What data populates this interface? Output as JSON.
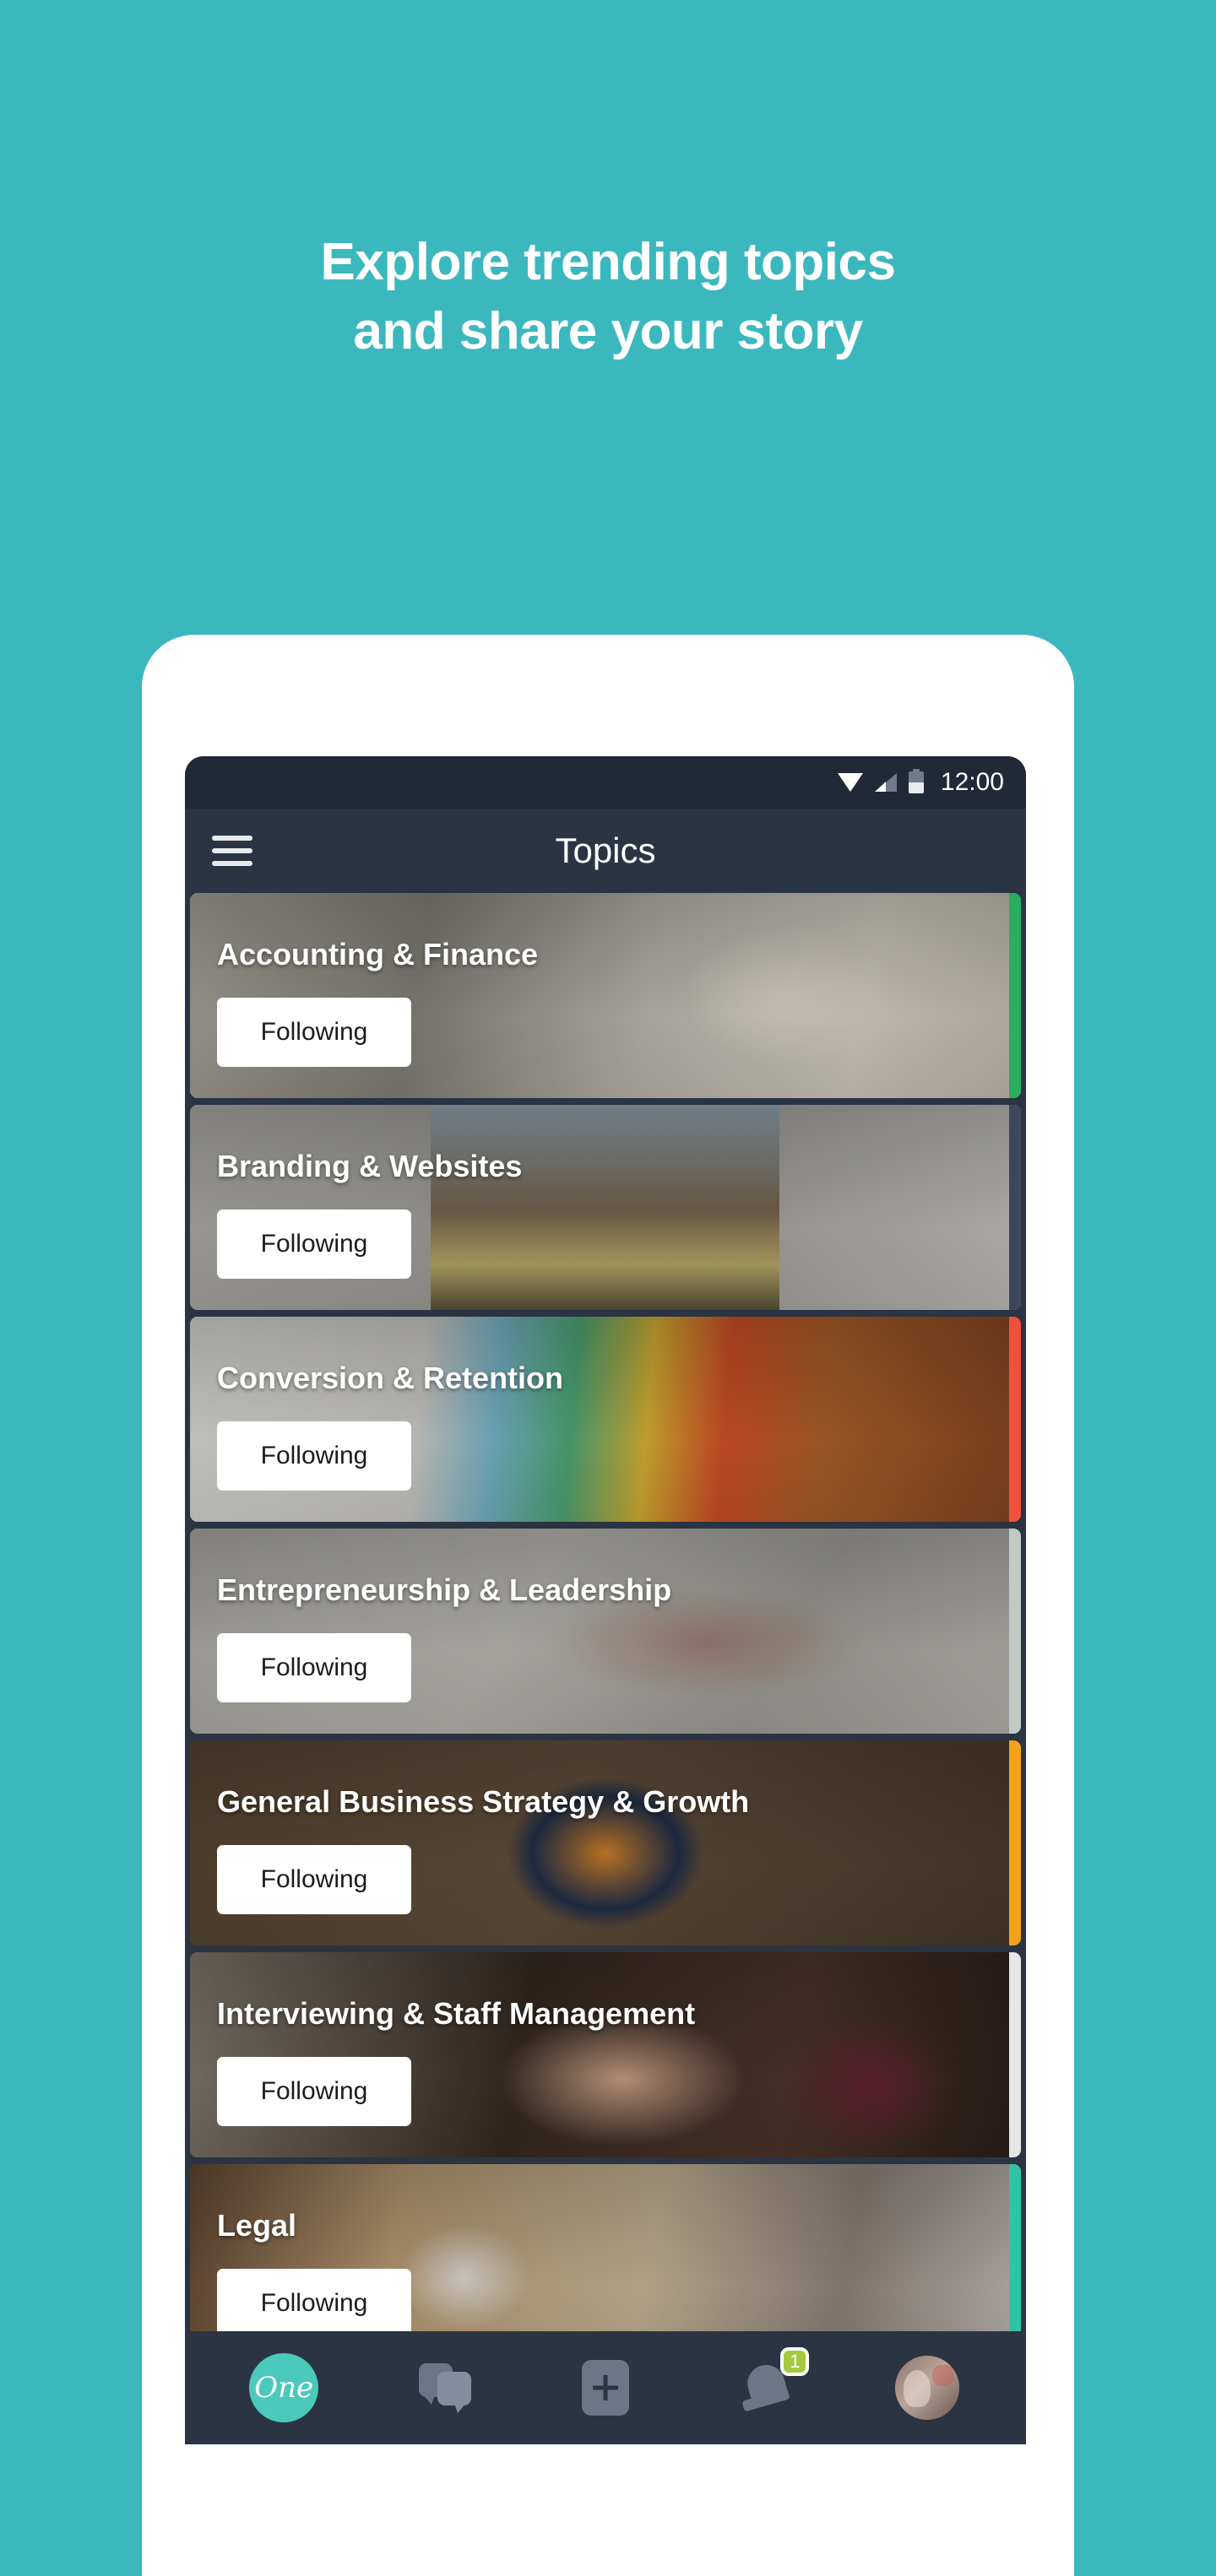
{
  "promo": {
    "headline": "Explore trending topics\nand share your story",
    "background_color": "#3BB8BE"
  },
  "status_bar": {
    "time": "12:00",
    "icons": [
      "wifi-icon",
      "signal-icon",
      "battery-icon"
    ]
  },
  "app_bar": {
    "menu_icon": "hamburger-menu-icon",
    "title": "Topics"
  },
  "topics": {
    "follow_label": "Following",
    "items": [
      {
        "title": "Accounting & Finance",
        "stripe_color": "#27AE5F"
      },
      {
        "title": "Branding & Websites",
        "stripe_color": "#3C4759"
      },
      {
        "title": "Conversion & Retention",
        "stripe_color": "#F0513C"
      },
      {
        "title": "Entrepreneurship & Leadership",
        "stripe_color": "#BFCBC4"
      },
      {
        "title": "General Business Strategy & Growth",
        "stripe_color": "#F5A218"
      },
      {
        "title": "Interviewing & Staff Management",
        "stripe_color": "#E6E6E6"
      },
      {
        "title": "Legal",
        "stripe_color": "#2EC4A3"
      }
    ]
  },
  "bottom_nav": {
    "items": [
      {
        "name": "home-logo",
        "label": "One"
      },
      {
        "name": "messages",
        "label": ""
      },
      {
        "name": "create-post",
        "label": ""
      },
      {
        "name": "notifications",
        "label": "",
        "badge": "1"
      },
      {
        "name": "profile",
        "label": ""
      }
    ],
    "badge_color": "#A4C83F",
    "logo_color": "#4BC9BC"
  }
}
